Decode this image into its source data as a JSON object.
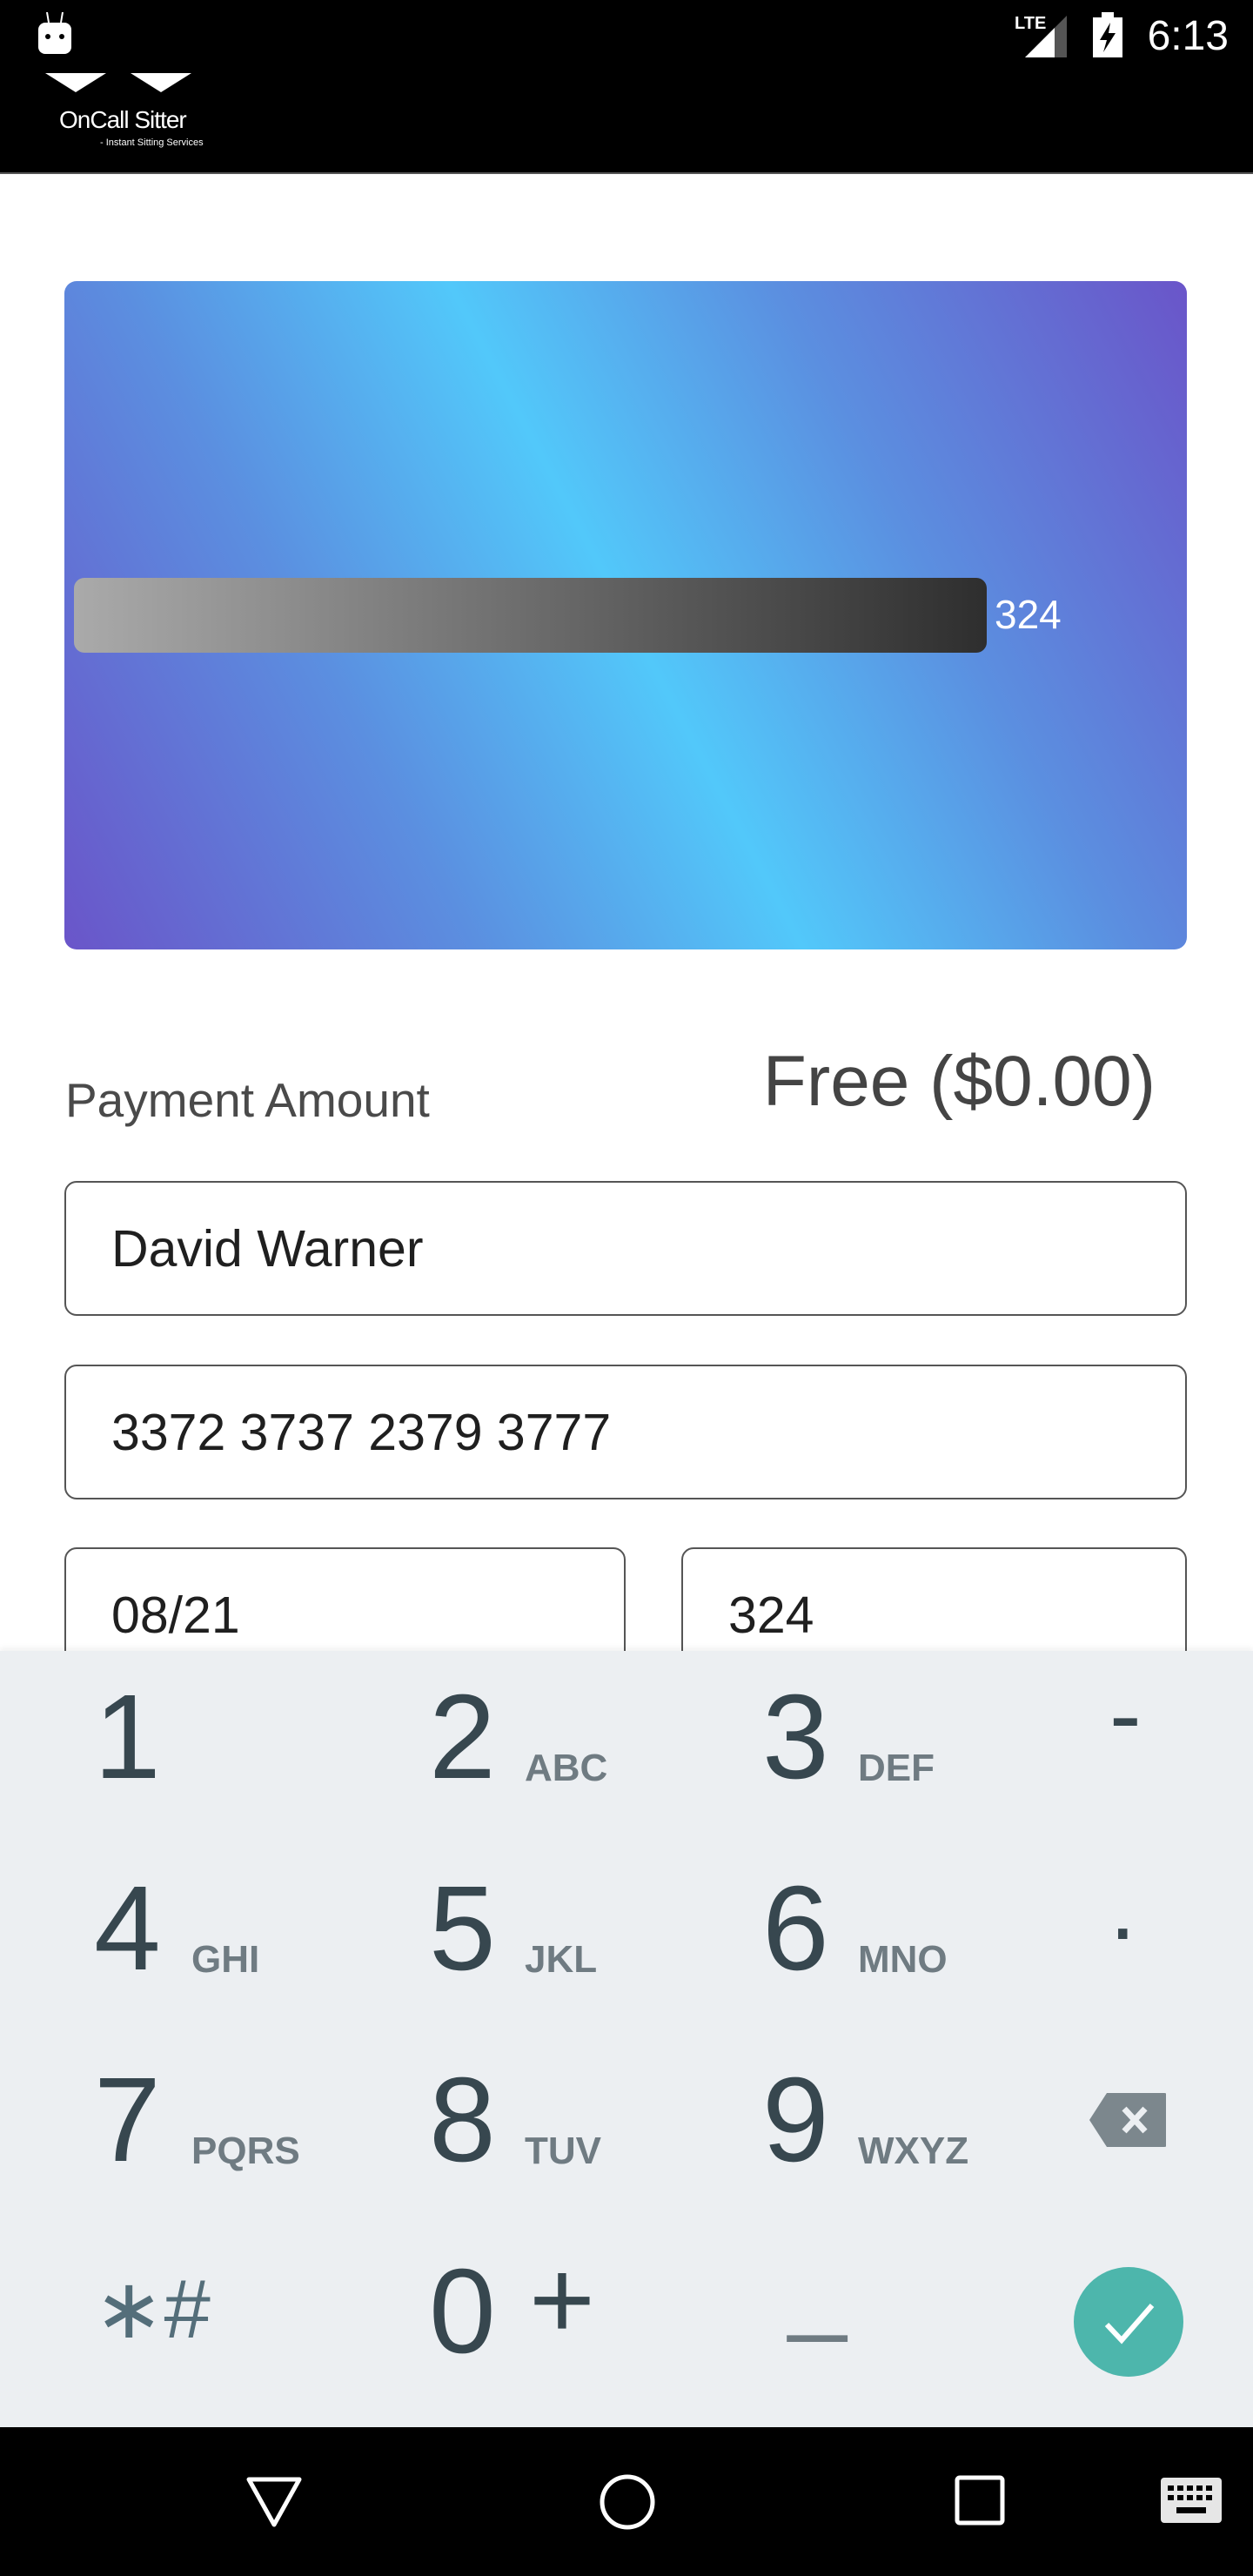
{
  "status_bar": {
    "time": "6:13",
    "network": "LTE",
    "icons": [
      "android-debug-icon",
      "signal-icon",
      "battery-charging-icon"
    ]
  },
  "app_bar": {
    "logo_title": "OnCall Sitter",
    "logo_subtitle": "- Instant Sitting Services"
  },
  "card_preview": {
    "cvv": "324"
  },
  "payment": {
    "label": "Payment Amount",
    "amount": "Free ($0.00)"
  },
  "form": {
    "name": "David Warner",
    "card_number": "3372 3737 2379 3777",
    "expiry": "08/21",
    "cvv": "324"
  },
  "keypad": {
    "keys": [
      {
        "digit": "1",
        "letters": ""
      },
      {
        "digit": "2",
        "letters": "ABC"
      },
      {
        "digit": "3",
        "letters": "DEF"
      },
      {
        "digit": "-",
        "letters": ""
      },
      {
        "digit": "4",
        "letters": "GHI"
      },
      {
        "digit": "5",
        "letters": "JKL"
      },
      {
        "digit": "6",
        "letters": "MNO"
      },
      {
        "digit": ".",
        "letters": ""
      },
      {
        "digit": "7",
        "letters": "PQRS"
      },
      {
        "digit": "8",
        "letters": "TUV"
      },
      {
        "digit": "9",
        "letters": "WXYZ"
      },
      {
        "digit": "",
        "letters": ""
      },
      {
        "digit": "∗#",
        "letters": ""
      },
      {
        "digit": "0",
        "letters": "+"
      },
      {
        "digit": "_",
        "letters": ""
      },
      {
        "digit": "",
        "letters": ""
      }
    ],
    "accent": "#4db6ac"
  },
  "nav_bar": {
    "icons": [
      "back-icon",
      "home-icon",
      "recents-icon",
      "keyboard-icon"
    ]
  }
}
